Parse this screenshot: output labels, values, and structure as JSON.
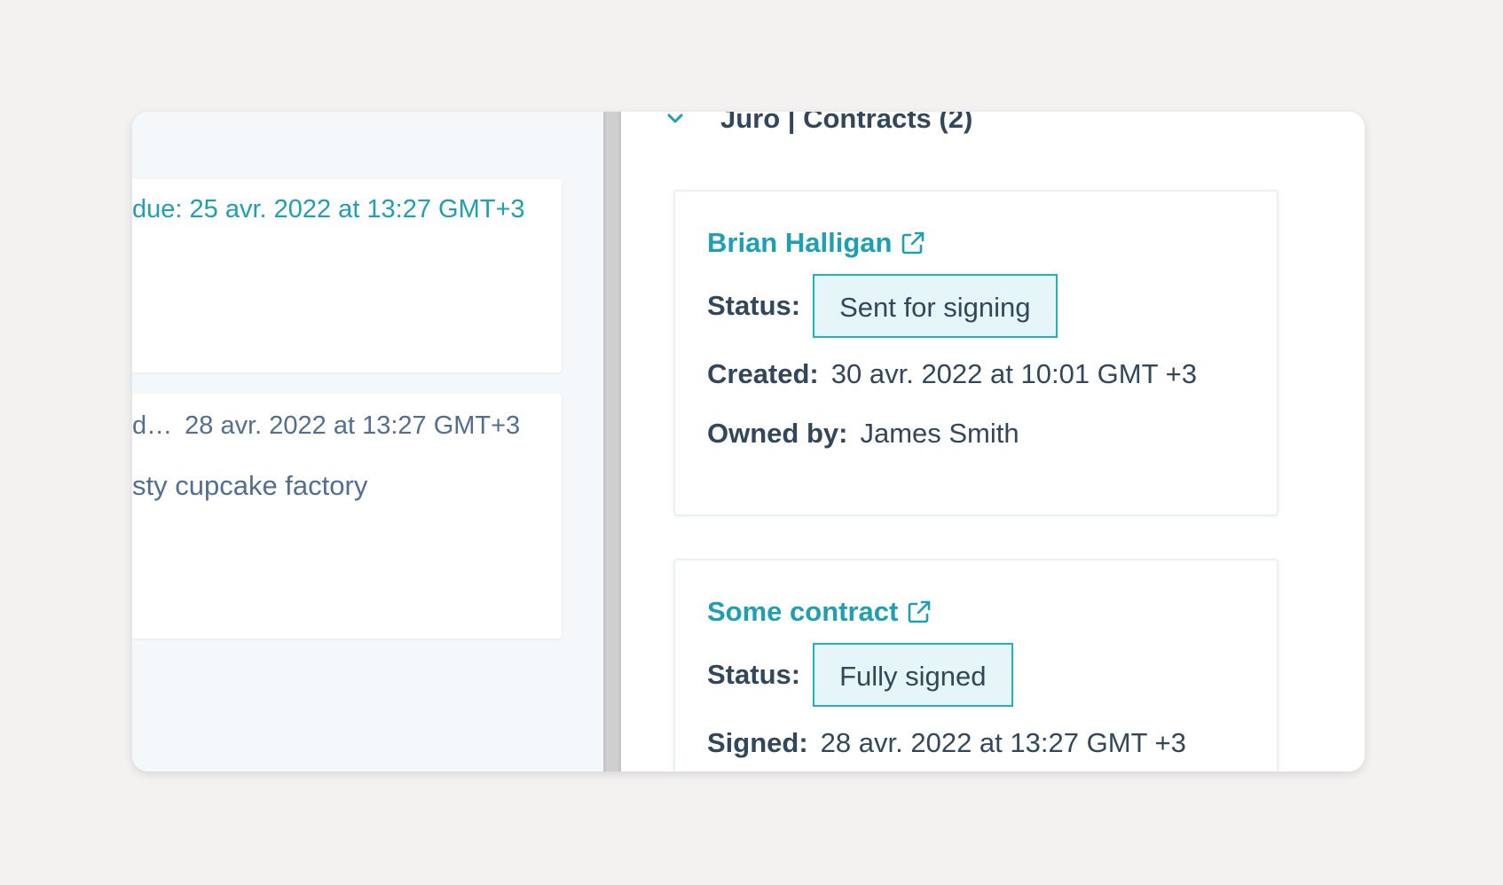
{
  "timeline": {
    "card1": {
      "due_text": "due: 25 avr. 2022 at 13:27 GMT+3"
    },
    "card2": {
      "activity_text": "d…",
      "timestamp": "28 avr. 2022 at 13:27 GMT+3",
      "description": "sty cupcake factory"
    }
  },
  "sidebar": {
    "section_title": "Juro | Contracts (2)",
    "contracts": [
      {
        "name": "Brian Halligan",
        "status_label": "Status:",
        "status": "Sent for signing",
        "created_label": "Created:",
        "created": "30 avr. 2022 at 10:01 GMT +3",
        "owner_label": "Owned by:",
        "owner": "James Smith"
      },
      {
        "name": "Some contract",
        "status_label": "Status:",
        "status": "Fully signed",
        "signed_label": "Signed:",
        "signed": "28 avr. 2022 at 13:27 GMT +3"
      }
    ]
  },
  "colors": {
    "accent": "#1f9fb3",
    "badge_border": "#1fb2c3",
    "badge_bg": "#e5f5f8",
    "text": "#33475b",
    "background": "#f3f2f1"
  },
  "icons": {
    "section_toggle": "chevron-down-icon",
    "open_contract": "external-link-icon"
  }
}
